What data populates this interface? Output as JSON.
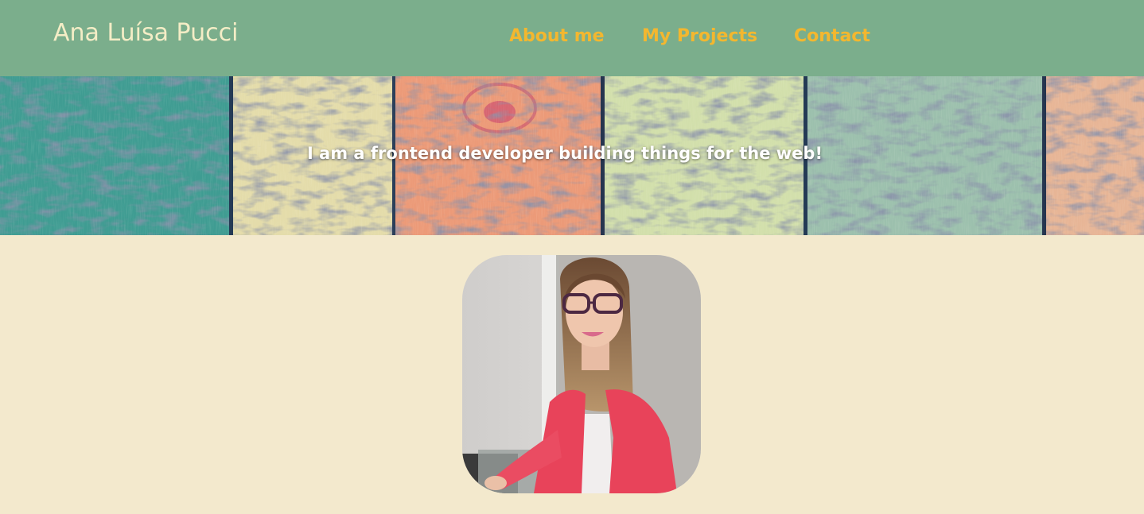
{
  "header": {
    "brand": "Ana Luísa Pucci",
    "nav": [
      {
        "label": "About me"
      },
      {
        "label": "My Projects"
      },
      {
        "label": "Contact"
      }
    ]
  },
  "hero": {
    "tagline": "I am a frontend developer building things for the web!"
  },
  "colors": {
    "header_bg": "#7bae8c",
    "brand_text": "#f4edc6",
    "nav_link": "#f3b72f",
    "page_bg": "#f3e9cd"
  }
}
